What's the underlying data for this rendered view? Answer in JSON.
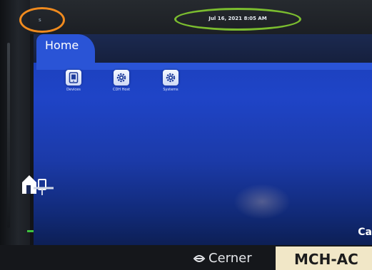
{
  "status_bar": {
    "datetime": "Jul 16, 2021 8:05 AM",
    "corner_mark": "s"
  },
  "home_tab": {
    "label": "Home"
  },
  "apps": [
    {
      "label": "Devices",
      "icon": "device-icon"
    },
    {
      "label": "CDH Host",
      "icon": "gear-icon"
    },
    {
      "label": "Systems",
      "icon": "gear-icon"
    }
  ],
  "screen_corner_text": "Ca",
  "brand": {
    "name": "Cerner"
  },
  "asset_tag": "MCH-AC",
  "colors": {
    "screen_blue": "#2a54d6",
    "highlight_orange": "#f08a1e",
    "highlight_green": "#7bbd2f",
    "status_led": "#3ec23e"
  }
}
